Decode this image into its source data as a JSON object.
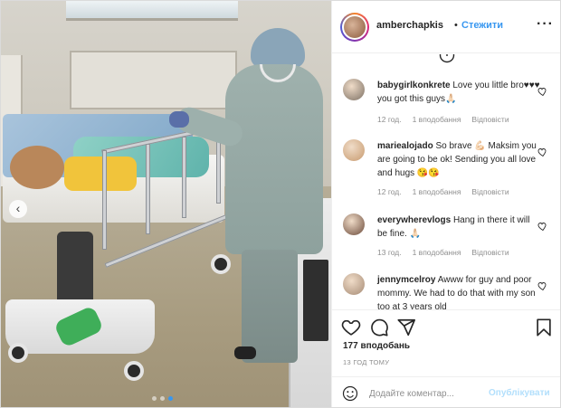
{
  "header": {
    "username": "amberchapkis",
    "separator": "•",
    "follow_label": "Стежити",
    "more_label": "···"
  },
  "comments": [
    {
      "username": "babygirlkonkrete",
      "text": "Love you little bro♥♥♥ you got this guys🙏🏻",
      "time": "12 год.",
      "likes": "1 вподобання",
      "reply": "Відповісти",
      "avatar_color": "#7b6f63"
    },
    {
      "username": "mariealojado",
      "text": "So brave 💪🏻 Maksim you are going to be ok! Sending you all love and hugs 😘😘",
      "time": "12 год.",
      "likes": "1 вподобання",
      "reply": "Відповісти",
      "avatar_color": "#c79a6e"
    },
    {
      "username": "everywherevlogs",
      "text": "Hang in there it will be fine. 🙏🏻",
      "time": "13 год.",
      "likes": "1 вподобання",
      "reply": "Відповісти",
      "avatar_color": "#6b4a3a"
    },
    {
      "username": "jennymcelroy",
      "text": "Awww for guy and poor mommy. We had to do that with my son too at 3 years old",
      "avatar_color": "#a58a74"
    }
  ],
  "post": {
    "likes": "177 вподобань",
    "time": "13 ГОД ТОМУ"
  },
  "composer": {
    "placeholder": "Додайте коментар...",
    "publish_label": "Опублікувати"
  },
  "carousel": {
    "prev_label": "‹",
    "dot_count": 3,
    "active_dot": 2
  },
  "icons": [
    "heart-icon",
    "comment-icon",
    "share-icon",
    "bookmark-icon",
    "emoji-icon",
    "info-icon"
  ],
  "colors": {
    "accent": "#3897f0",
    "muted": "#8e8e8e",
    "publish_disabled": "#b2dffc"
  }
}
